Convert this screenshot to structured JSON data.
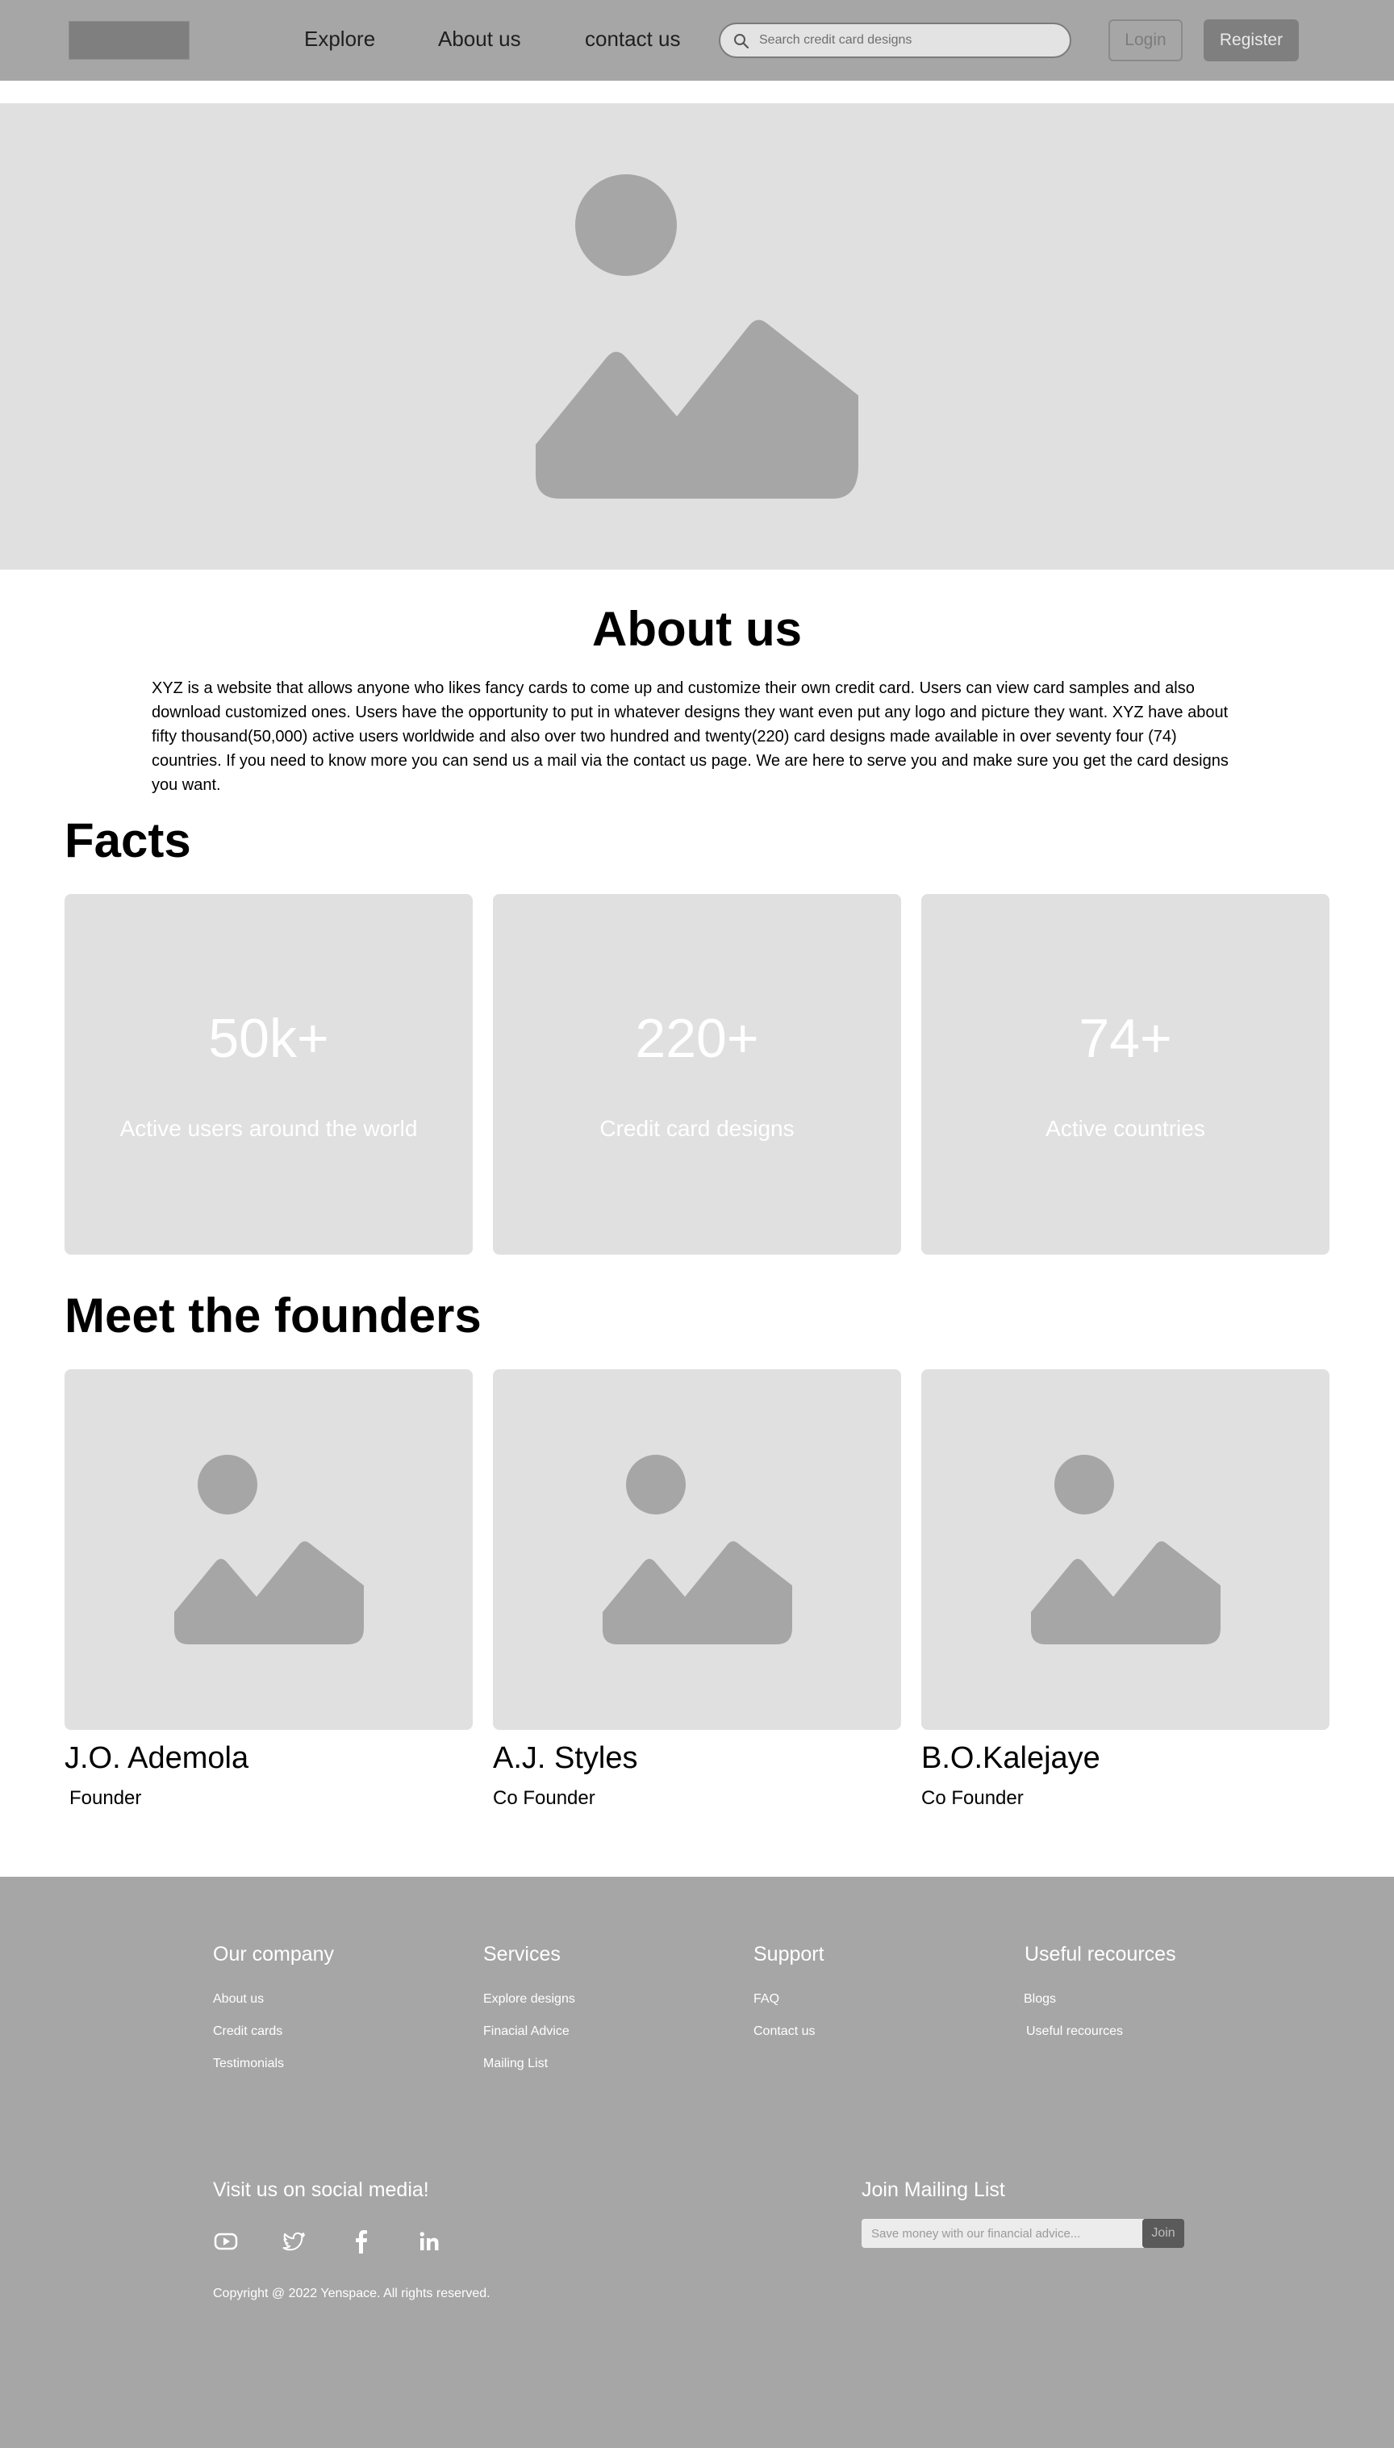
{
  "header": {
    "nav": [
      "Explore",
      "About us",
      "contact us"
    ],
    "search_placeholder": "Search credit card designs",
    "login_label": "Login",
    "register_label": "Register"
  },
  "about": {
    "title": "About us",
    "text": "XYZ is a website that allows anyone who likes fancy cards to come up and customize their own credit card. Users can view card samples and also download customized ones. Users have the opportunity to put in whatever designs they want even put any logo and picture they want. XYZ have about fifty thousand(50,000) active users worldwide and also over two hundred and twenty(220) card designs made available in over seventy four (74) countries. If you need to know more you can send us a mail via the contact us page. We are here to serve you and make sure you get the card designs you want."
  },
  "facts": {
    "title": "Facts",
    "items": [
      {
        "value": "50k+",
        "label": "Active users around the world"
      },
      {
        "value": "220+",
        "label": "Credit card designs"
      },
      {
        "value": "74+",
        "label": "Active countries"
      }
    ]
  },
  "founders": {
    "title": "Meet the founders",
    "items": [
      {
        "name": "J.O. Ademola",
        "role": "Founder"
      },
      {
        "name": "A.J. Styles",
        "role": "Co Founder"
      },
      {
        "name": "B.O.Kalejaye",
        "role": "Co Founder"
      }
    ]
  },
  "footer": {
    "columns": [
      {
        "title": "Our company",
        "links": [
          "About us",
          "Credit cards",
          "Testimonials"
        ]
      },
      {
        "title": "Services",
        "links": [
          "Explore designs",
          "Finacial Advice",
          "Mailing List"
        ]
      },
      {
        "title": "Support",
        "links": [
          "FAQ",
          "Contact us"
        ]
      },
      {
        "title": "Useful recources",
        "links": [
          "Blogs",
          "Useful recources"
        ]
      }
    ],
    "social_title": "Visit us on social media!",
    "social_icons": [
      "youtube-icon",
      "twitter-icon",
      "facebook-icon",
      "linkedin-icon"
    ],
    "copyright": "Copyright @ 2022 Yenspace. All rights reserved.",
    "mailing_title": "Join Mailing List",
    "mailing_placeholder": "Save money with our financial advice...",
    "join_label": "Join"
  },
  "colors": {
    "header_bg": "#a6a6a6",
    "placeholder_bg": "#e0e0e0",
    "image_icon": "#a6a6a6",
    "footer_bg": "#a6a6a6"
  }
}
